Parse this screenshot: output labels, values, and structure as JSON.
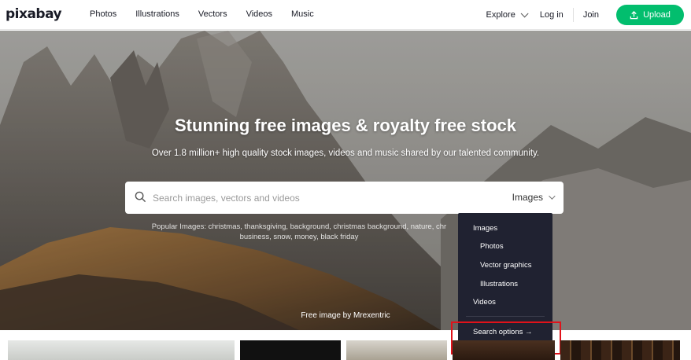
{
  "brand": {
    "logo": "pixabay"
  },
  "nav": {
    "items": [
      "Photos",
      "Illustrations",
      "Vectors",
      "Videos",
      "Music"
    ]
  },
  "header": {
    "explore": "Explore",
    "login": "Log in",
    "join": "Join",
    "upload": "Upload"
  },
  "hero": {
    "title": "Stunning free images & royalty free stock",
    "subtitle": "Over 1.8 million+ high quality stock images, videos and music shared by our talented community.",
    "popular_line1": "Popular Images: christmas, thanksgiving, background, christmas background, nature, chr",
    "popular_line2": "business, snow, money, black friday",
    "credit": "Free image by Mrexentric"
  },
  "search": {
    "placeholder": "Search images, vectors and videos",
    "value": "",
    "type": "Images"
  },
  "dropdown": {
    "images": "Images",
    "photos": "Photos",
    "vector_graphics": "Vector graphics",
    "illustrations": "Illustrations",
    "videos": "Videos",
    "search_options": "Search options →"
  },
  "colors": {
    "accent": "#02be6e",
    "dropdown_bg": "#202231",
    "highlight": "#e0121a"
  },
  "icons": {
    "search": "search-icon",
    "upload": "upload-icon",
    "explore_chevron": "chevron-down-icon",
    "select_chevron": "chevron-down-icon"
  }
}
